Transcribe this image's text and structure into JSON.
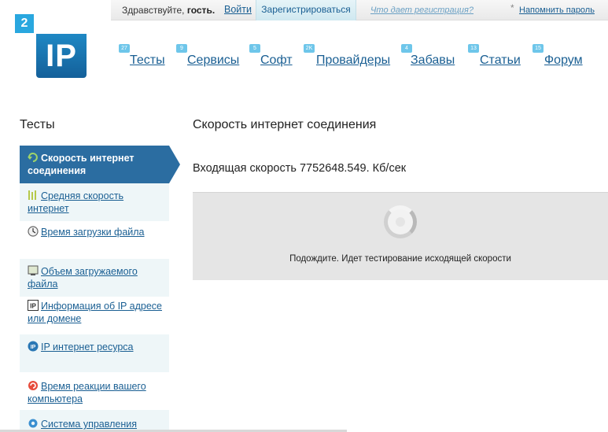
{
  "topbar": {
    "greeting_prefix": "Здравствуйте,",
    "greeting_user": "гость.",
    "login": "Войти",
    "register": "Зарегистрироваться",
    "what_registration": "Что дает регистрация?",
    "asterisk": "*",
    "remind_password": "Напомнить пароль"
  },
  "logo": {
    "badge": "2",
    "text": "IP"
  },
  "nav": [
    {
      "badge": "27",
      "label": "Тесты"
    },
    {
      "badge": "9",
      "label": "Сервисы"
    },
    {
      "badge": "5",
      "label": "Софт"
    },
    {
      "badge": "2K",
      "label": "Провайдеры"
    },
    {
      "badge": "4",
      "label": "Забавы"
    },
    {
      "badge": "13",
      "label": "Статьи"
    },
    {
      "badge": "15",
      "label": "Форум"
    }
  ],
  "sidebar": {
    "title": "Тесты",
    "items": [
      {
        "label": "Скорость интернет соединения",
        "icon": "refresh-arrow-icon"
      },
      {
        "label": "Средняя скорость интернет",
        "icon": "bars-icon"
      },
      {
        "label": "Время загрузки файла",
        "icon": "clock-icon"
      },
      {
        "label": "Объем загружаемого файла",
        "icon": "monitor-icon"
      },
      {
        "label": "Информация об IP адресе или домене",
        "icon": "ip-icon"
      },
      {
        "label": "IP интернет ресурса",
        "icon": "ip-circle-icon"
      },
      {
        "label": "Время реакции вашего компьютера",
        "icon": "reaction-icon"
      },
      {
        "label": "Система управления",
        "icon": "gear-icon"
      }
    ]
  },
  "main": {
    "title": "Скорость интернет соединения",
    "incoming_speed": "Входящая скорость 7752648.549. Кб/сек",
    "wait_message": "Подождите. Идет тестирование исходящей скорости"
  },
  "colors": {
    "link": "#1a5f93",
    "active": "#2b6da1",
    "accent": "#29a7df"
  }
}
